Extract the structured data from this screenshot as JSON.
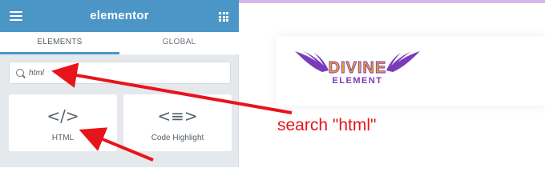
{
  "panel": {
    "brand": "elementor",
    "tabs": [
      "ELEMENTS",
      "GLOBAL"
    ],
    "search": {
      "value": "html"
    },
    "widgets": [
      {
        "label": "HTML",
        "icon": "code-icon"
      },
      {
        "label": "Code Highlight",
        "icon": "code-highlight-icon"
      }
    ]
  },
  "canvas": {
    "logo": {
      "line1": "DIVINE",
      "line2": "ELEMENT"
    },
    "annotation": "search \"html\""
  },
  "colors": {
    "header": "#4a97c7",
    "panel_bg": "#e6e9ec",
    "annotation": "#e8141c",
    "logo_wing": "#7a3bb8",
    "logo_text": "#f3a51c"
  }
}
